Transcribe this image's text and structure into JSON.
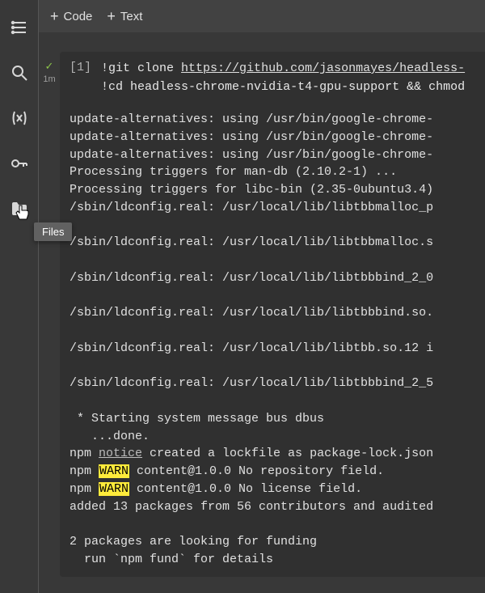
{
  "sidebar": {
    "icons": {
      "toc": "toc-icon",
      "search": "search-icon",
      "vars": "variables-icon",
      "secret": "key-icon",
      "files": "folder-icon"
    },
    "tooltip": "Files"
  },
  "toolbar": {
    "code_label": "Code",
    "text_label": "Text"
  },
  "cell": {
    "status_check": "✓",
    "duration": "1m",
    "exec_count": "[1]",
    "code_prefix1": "!",
    "code_cmd1": "git clone ",
    "code_url1": "https://github.com/jasonmayes/headless-",
    "code_prefix2": "!",
    "code_cmd2": "cd headless-chrome-nvidia-t4-gpu-support && chmod"
  },
  "output": {
    "lines_pre": "update-alternatives: using /usr/bin/google-chrome-\nupdate-alternatives: using /usr/bin/google-chrome-\nupdate-alternatives: using /usr/bin/google-chrome-\nProcessing triggers for man-db (2.10.2-1) ...\nProcessing triggers for libc-bin (2.35-0ubuntu3.4)\n/sbin/ldconfig.real: /usr/local/lib/libtbbmalloc_p\n\n/sbin/ldconfig.real: /usr/local/lib/libtbbmalloc.s\n\n/sbin/ldconfig.real: /usr/local/lib/libtbbbind_2_0\n\n/sbin/ldconfig.real: /usr/local/lib/libtbbbind.so.\n\n/sbin/ldconfig.real: /usr/local/lib/libtbb.so.12 i\n\n/sbin/ldconfig.real: /usr/local/lib/libtbbbind_2_5\n\n * Starting system message bus dbus\n   ...done.",
    "npm_prefix": "npm ",
    "npm_notice_word": "notice",
    "npm_notice_rest": " created a lockfile as package-lock.json",
    "npm_warn_word": "WARN",
    "npm_warn1_rest": " content@1.0.0 No repository field.",
    "npm_warn2_rest": " content@1.0.0 No license field.",
    "lines_post": "\nadded 13 packages from 56 contributors and audited\n\n2 packages are looking for funding\n  run `npm fund` for details"
  }
}
